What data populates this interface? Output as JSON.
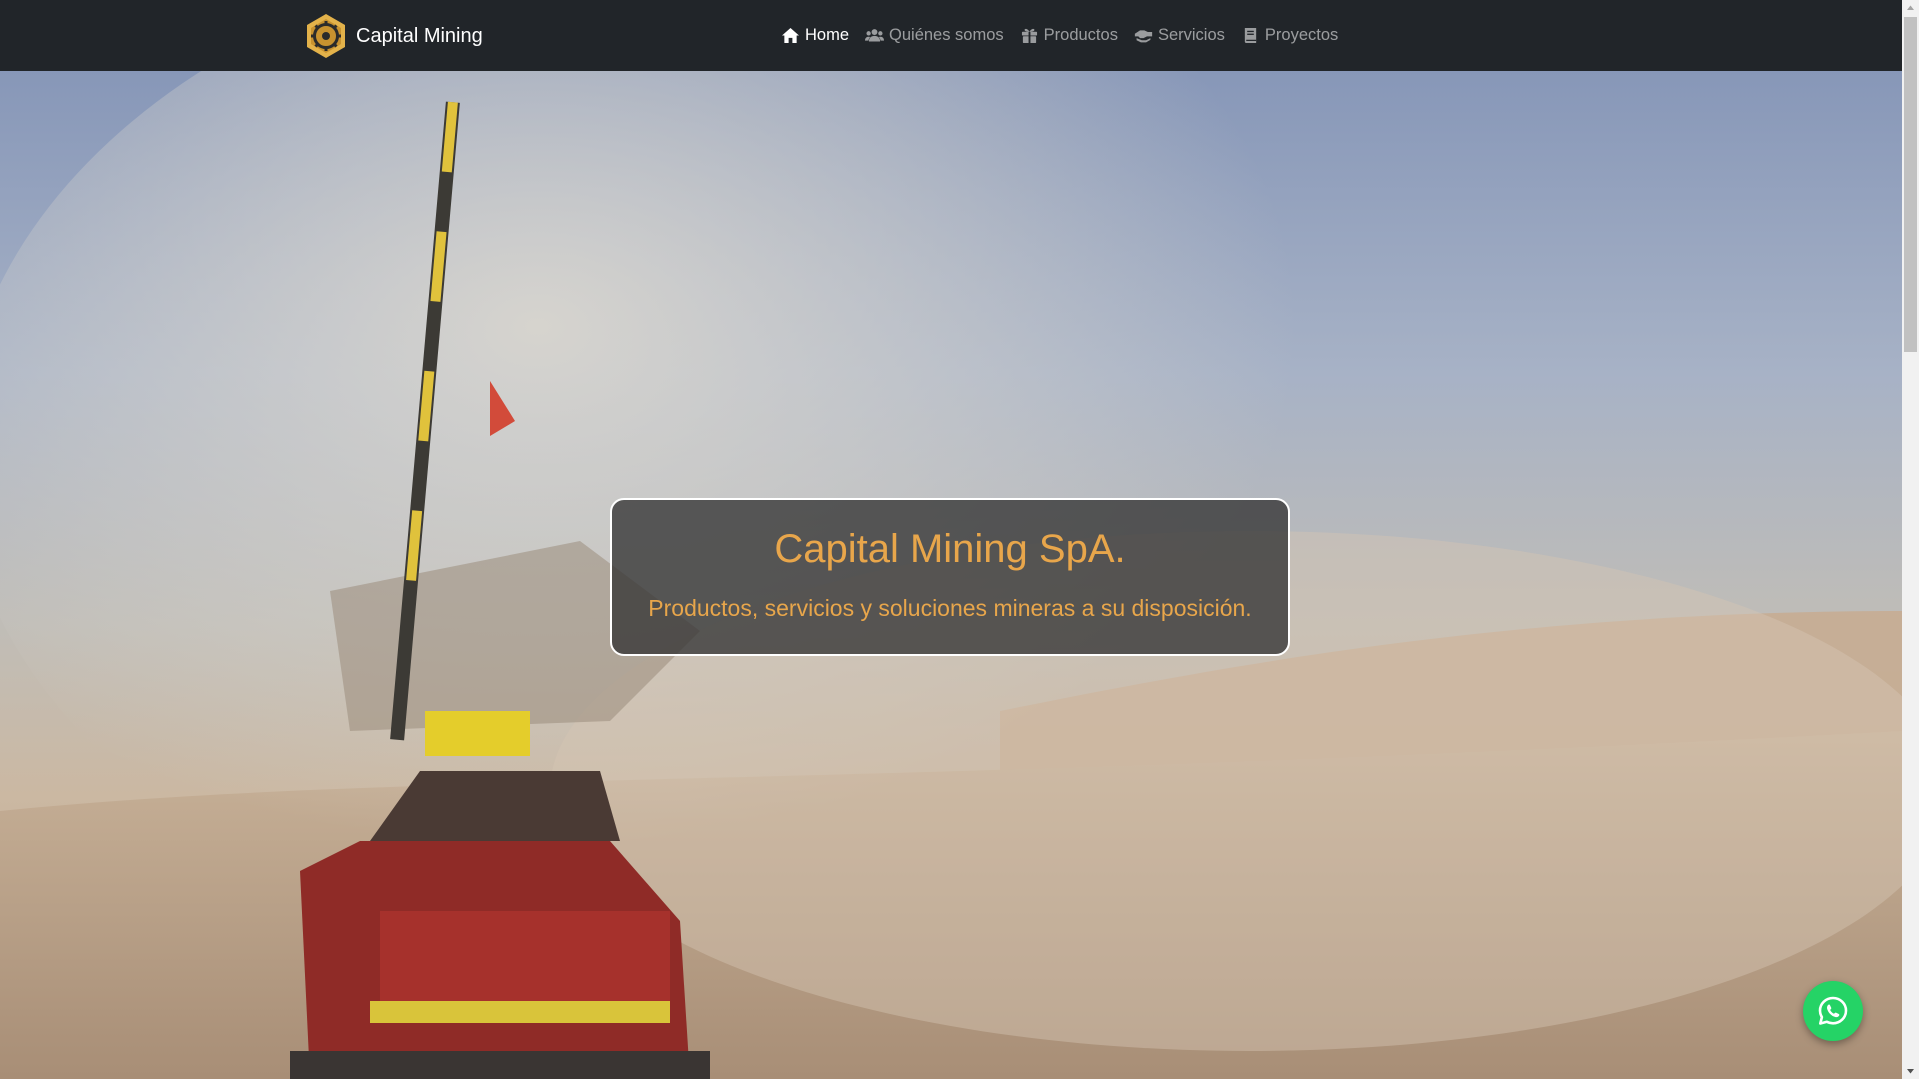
{
  "navbar": {
    "brand": {
      "name": "Capital Mining",
      "logo_icon": "gear-hexagon-logo-icon"
    },
    "links": [
      {
        "label": "Home",
        "icon": "home-icon",
        "active": true
      },
      {
        "label": "Quiénes somos",
        "icon": "users-icon",
        "active": false
      },
      {
        "label": "Productos",
        "icon": "gift-icon",
        "active": false
      },
      {
        "label": "Servicios",
        "icon": "handshake-icon",
        "active": false
      },
      {
        "label": "Proyectos",
        "icon": "book-icon",
        "active": false
      }
    ]
  },
  "hero": {
    "background": "mining-site-photo",
    "title": "Capital Mining SpA.",
    "subtitle": "Productos, servicios y soluciones mineras a su disposición."
  },
  "whatsapp": {
    "icon": "whatsapp-icon"
  },
  "colors": {
    "navbar_bg": "#212529",
    "accent": "#e8a64b",
    "whatsapp_green": "#25d366",
    "nav_inactive": "rgba(255,255,255,0.55)"
  }
}
